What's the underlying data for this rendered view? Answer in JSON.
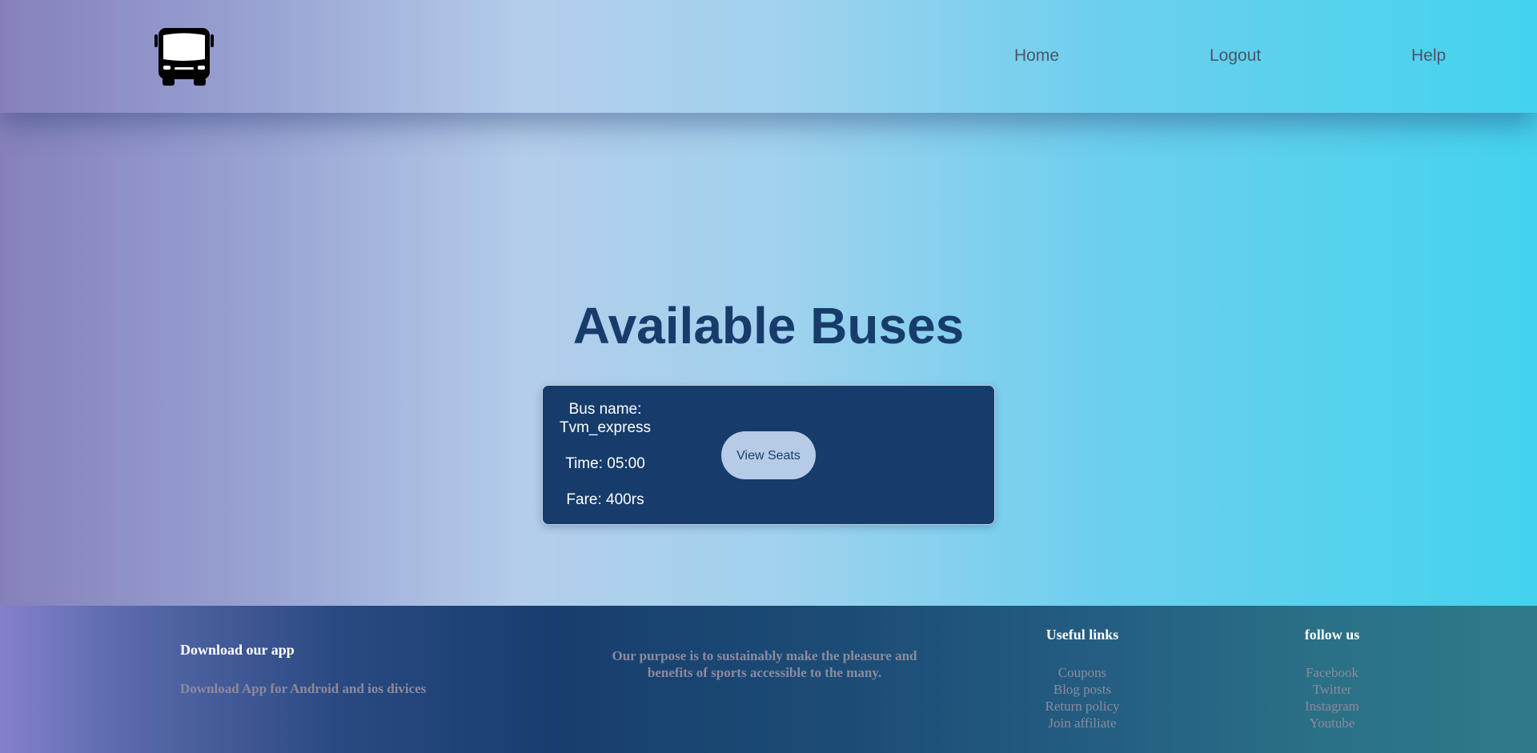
{
  "header": {
    "logo_icon": "bus-icon",
    "nav": [
      {
        "label": "Home"
      },
      {
        "label": "Logout"
      },
      {
        "label": "Help"
      }
    ]
  },
  "main": {
    "title": "Available Buses",
    "buses": [
      {
        "name_label": "Bus name:",
        "name": "Tvm_express",
        "time": "Time: 05:00",
        "fare": "Fare: 400rs",
        "view_button": "View Seats"
      }
    ]
  },
  "footer": {
    "app": {
      "heading": "Download our app",
      "text": "Download App for Android and ios divices"
    },
    "purpose": "Our purpose is to sustainably make the pleasure and benefits of sports accessible to the many.",
    "useful_links": {
      "heading": "Useful links",
      "items": [
        "Coupons",
        "Blog posts",
        "Return policy",
        "Join affiliate"
      ]
    },
    "follow": {
      "heading": "follow us",
      "items": [
        "Facebook",
        "Twitter",
        "Instagram",
        "Youtube"
      ]
    }
  },
  "colors": {
    "title": "#173c6c",
    "card_bg": "#163c6c",
    "button_bg": "#b5cbe6",
    "footer_muted_text": "#8e8a9c",
    "nav_text": "#4c5668"
  }
}
